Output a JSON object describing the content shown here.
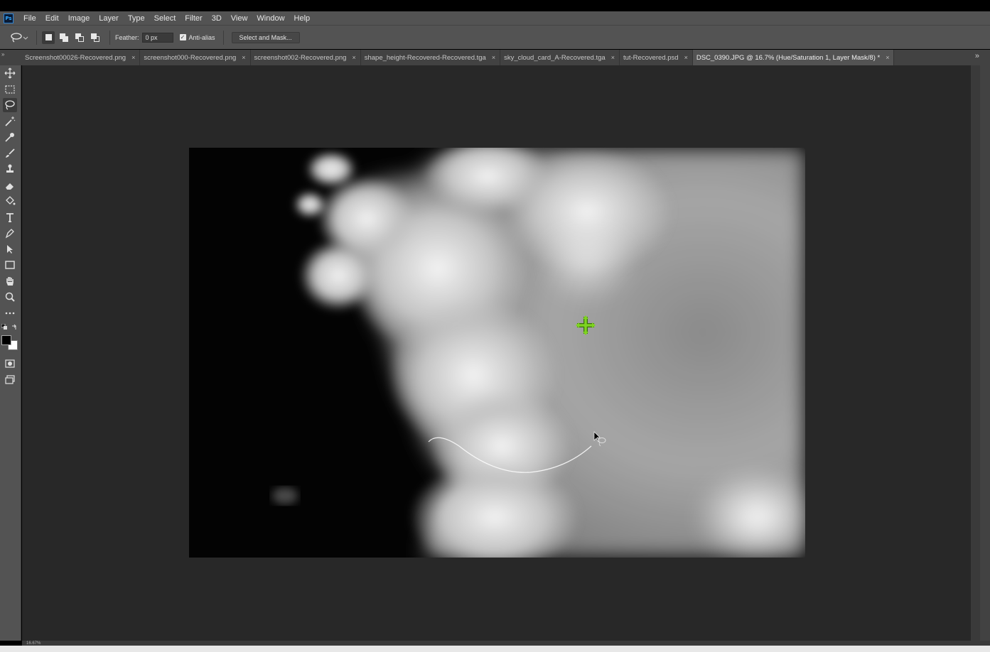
{
  "app": {
    "logo_text": "Ps"
  },
  "menu": [
    "File",
    "Edit",
    "Image",
    "Layer",
    "Type",
    "Select",
    "Filter",
    "3D",
    "View",
    "Window",
    "Help"
  ],
  "options": {
    "tool_icon": "lasso-icon",
    "feather_label": "Feather:",
    "feather_value": "0 px",
    "antialias_label": "Anti-alias",
    "antialias_checked": true,
    "select_and_mask": "Select and Mask..."
  },
  "tabs": [
    {
      "label": "Screenshot00026-Recovered.png",
      "active": false
    },
    {
      "label": "screenshot000-Recovered.png",
      "active": false
    },
    {
      "label": "screenshot002-Recovered.png",
      "active": false
    },
    {
      "label": "shape_height-Recovered-Recovered.tga",
      "active": false
    },
    {
      "label": "sky_cloud_card_A-Recovered.tga",
      "active": false
    },
    {
      "label": "tut-Recovered.psd",
      "active": false
    },
    {
      "label": "DSC_0390.JPG @ 16.7% (Hue/Saturation 1, Layer Mask/8) *",
      "active": true
    }
  ],
  "tab_close_glyph": "×",
  "tab_overflow_glyph": "»",
  "tab_collapse_glyph": "»",
  "tools": [
    "move-icon",
    "rectangular-marquee-icon",
    "lasso-icon",
    "magic-wand-icon",
    "eyedropper-icon",
    "brush-icon",
    "clone-stamp-icon",
    "eraser-icon",
    "paint-bucket-icon",
    "type-icon",
    "pen-icon",
    "path-selection-icon",
    "rectangle-icon",
    "hand-icon",
    "zoom-icon",
    "more-tools-icon",
    "foreground-background-colors",
    "quick-mask-icon",
    "screen-mode-icon"
  ],
  "colors": {
    "foreground": "#000000",
    "background": "#ffffff",
    "cursor_green": "#7ed321",
    "panel": "#535353",
    "canvas_bg": "#282828"
  },
  "document": {
    "image": "grayscale cloud photo with lasso path in progress",
    "cursor_icon": "move-crosshair-icon",
    "lasso_cursor_icon": "lasso-cursor-icon"
  },
  "status": {
    "zoom": "16.67%"
  }
}
